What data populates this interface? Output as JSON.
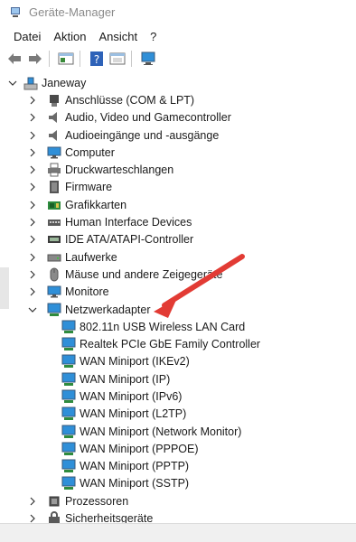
{
  "window": {
    "title": "Geräte-Manager"
  },
  "menu": [
    {
      "label": "Datei"
    },
    {
      "label": "Aktion"
    },
    {
      "label": "Ansicht"
    },
    {
      "label": "?"
    }
  ],
  "colors": {
    "arrow": "#e23b34",
    "monitor": "#2f8fd8",
    "titleText": "#8a8a8a"
  },
  "tree": {
    "root": {
      "label": "Janeway",
      "icon": "computer-root-icon",
      "expanded": true
    },
    "categories": [
      {
        "label": "Anschlüsse (COM & LPT)",
        "icon": "port-icon"
      },
      {
        "label": "Audio, Video und Gamecontroller",
        "icon": "speaker-icon"
      },
      {
        "label": "Audioeingänge und -ausgänge",
        "icon": "speaker-icon"
      },
      {
        "label": "Computer",
        "icon": "monitor-icon"
      },
      {
        "label": "Druckwarteschlangen",
        "icon": "printer-icon"
      },
      {
        "label": "Firmware",
        "icon": "firmware-icon"
      },
      {
        "label": "Grafikkarten",
        "icon": "graphics-card-icon"
      },
      {
        "label": "Human Interface Devices",
        "icon": "hid-icon"
      },
      {
        "label": "IDE ATA/ATAPI-Controller",
        "icon": "ide-controller-icon"
      },
      {
        "label": "Laufwerke",
        "icon": "disk-drive-icon"
      },
      {
        "label": "Mäuse und andere Zeigegeräte",
        "icon": "mouse-icon"
      },
      {
        "label": "Monitore",
        "icon": "monitor-icon"
      }
    ],
    "network": {
      "label": "Netzwerkadapter",
      "icon": "network-adapter-icon",
      "expanded": true,
      "children": [
        {
          "label": "802.11n USB Wireless LAN Card"
        },
        {
          "label": "Realtek PCIe GbE Family Controller"
        },
        {
          "label": "WAN Miniport (IKEv2)"
        },
        {
          "label": "WAN Miniport (IP)"
        },
        {
          "label": "WAN Miniport (IPv6)"
        },
        {
          "label": "WAN Miniport (L2TP)"
        },
        {
          "label": "WAN Miniport (Network Monitor)"
        },
        {
          "label": "WAN Miniport (PPPOE)"
        },
        {
          "label": "WAN Miniport (PPTP)"
        },
        {
          "label": "WAN Miniport (SSTP)"
        }
      ]
    },
    "after": [
      {
        "label": "Prozessoren",
        "icon": "processor-icon"
      },
      {
        "label": "Sicherheitsgeräte",
        "icon": "security-device-icon"
      }
    ]
  }
}
